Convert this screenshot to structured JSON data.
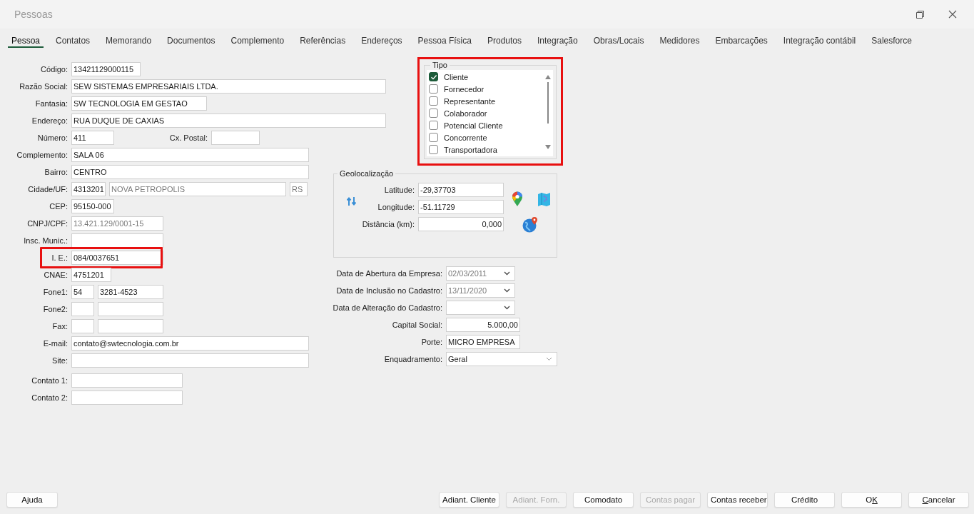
{
  "window": {
    "title": "Pessoas"
  },
  "tabs": [
    {
      "label": "Pessoa",
      "selected": true
    },
    {
      "label": "Contatos",
      "selected": false
    },
    {
      "label": "Memorando",
      "selected": false
    },
    {
      "label": "Documentos",
      "selected": false
    },
    {
      "label": "Complemento",
      "selected": false
    },
    {
      "label": "Referências",
      "selected": false
    },
    {
      "label": "Endereços",
      "selected": false
    },
    {
      "label": "Pessoa Física",
      "selected": false
    },
    {
      "label": "Produtos",
      "selected": false
    },
    {
      "label": "Integração",
      "selected": false
    },
    {
      "label": "Obras/Locais",
      "selected": false
    },
    {
      "label": "Medidores",
      "selected": false
    },
    {
      "label": "Embarcações",
      "selected": false
    },
    {
      "label": "Integração contábil",
      "selected": false
    },
    {
      "label": "Salesforce",
      "selected": false
    }
  ],
  "person_fields": [
    {
      "kind": "text",
      "label": "Código:",
      "fields": [
        {
          "value": "13421129000115",
          "disabled": false
        }
      ]
    },
    {
      "kind": "text",
      "label": "Razão Social:",
      "fields": [
        {
          "value": "SEW SISTEMAS EMPRESARIAIS LTDA.",
          "disabled": false
        }
      ]
    },
    {
      "kind": "text",
      "label": "Fantasia:",
      "fields": [
        {
          "value": "SW TECNOLOGIA EM GESTAO",
          "disabled": false
        }
      ]
    },
    {
      "kind": "text",
      "label": "Endereço:",
      "fields": [
        {
          "value": "RUA DUQUE DE CAXIAS",
          "disabled": false
        }
      ]
    },
    {
      "kind": "text",
      "label": "Número:",
      "fields": [
        {
          "value": "411",
          "disabled": false
        }
      ],
      "secondary": {
        "label": "Cx. Postal:"
      }
    },
    {
      "kind": "text",
      "label": "Complemento:",
      "fields": [
        {
          "value": "SALA 06",
          "disabled": false
        }
      ]
    },
    {
      "kind": "text",
      "label": "Bairro:",
      "fields": [
        {
          "value": "CENTRO",
          "disabled": false
        }
      ]
    },
    {
      "kind": "city",
      "label": "Cidade/UF:",
      "fields": [
        {
          "value": "4313201",
          "disabled": false
        },
        {
          "value": "NOVA PETROPOLIS",
          "disabled": true
        },
        {
          "value": "RS",
          "disabled": true
        }
      ]
    },
    {
      "kind": "text",
      "label": "CEP:",
      "fields": [
        {
          "value": "95150-000",
          "disabled": false
        }
      ]
    },
    {
      "kind": "text",
      "label": "CNPJ/CPF:",
      "fields": [
        {
          "value": "13.421.129/0001-15",
          "disabled": true
        }
      ]
    },
    {
      "kind": "text",
      "label": "Insc. Munic.:"
    },
    {
      "kind": "text",
      "label": "I. E.:",
      "highlighted": true,
      "fields": [
        {
          "value": "084/0037651",
          "disabled": false
        }
      ]
    },
    {
      "kind": "text",
      "label": "CNAE:",
      "fields": [
        {
          "value": "4751201",
          "disabled": false
        }
      ]
    },
    {
      "kind": "phone",
      "label": "Fone1:",
      "fields": [
        {
          "value": "54",
          "disabled": false
        },
        {
          "value": "3281-4523",
          "disabled": false
        }
      ]
    },
    {
      "kind": "phone",
      "label": "Fone2:"
    },
    {
      "kind": "phone",
      "label": "Fax:"
    },
    {
      "kind": "text",
      "label": "E-mail:",
      "fields": [
        {
          "value": "contato@swtecnologia.com.br",
          "disabled": false
        }
      ]
    },
    {
      "kind": "text",
      "label": "Site:"
    },
    {
      "kind": "text",
      "label": "Contato 1:"
    },
    {
      "kind": "text",
      "label": "Contato 2:"
    }
  ],
  "tipo": {
    "title": "Tipo",
    "highlighted": true,
    "items": [
      {
        "label": "Cliente",
        "checked": true
      },
      {
        "label": "Fornecedor",
        "checked": false
      },
      {
        "label": "Representante",
        "checked": false
      },
      {
        "label": "Colaborador",
        "checked": false
      },
      {
        "label": "Potencial Cliente",
        "checked": false
      },
      {
        "label": "Concorrente",
        "checked": false
      },
      {
        "label": "Transportadora",
        "checked": false
      }
    ]
  },
  "geolocation": {
    "title": "Geolocalização",
    "rows": [
      {
        "kind": "coordinate",
        "label": "Latitude:",
        "value": "-29,37703"
      },
      {
        "kind": "coordinate",
        "label": "Longitude:",
        "value": "-51.11729"
      },
      {
        "kind": "number",
        "label": "Distância (km):",
        "value": "0,000"
      }
    ]
  },
  "company_fields": [
    {
      "kind": "date",
      "label": "Data de Abertura da Empresa:",
      "value": "02/03/2011",
      "disabled": true
    },
    {
      "kind": "date",
      "label": "Data de Inclusão no Cadastro:",
      "value": "13/11/2020",
      "disabled": true
    },
    {
      "kind": "date",
      "label": "Data de Alteração do Cadastro:"
    },
    {
      "kind": "number",
      "label": "Capital Social:",
      "value": "5.000,00",
      "disabled": false
    },
    {
      "kind": "text",
      "label": "Porte:",
      "value": "MICRO EMPRESA",
      "disabled": false
    },
    {
      "kind": "select",
      "label": "Enquadramento:",
      "value": "Geral",
      "disabled": false
    }
  ],
  "help_button": {
    "label": "Ajuda"
  },
  "buttons": [
    {
      "label": "Adiant. Cliente",
      "disabled": false
    },
    {
      "label": "Adiant. Forn.",
      "disabled": true
    },
    {
      "label": "Comodato",
      "disabled": false
    },
    {
      "label": "Contas pagar",
      "disabled": true
    },
    {
      "label": "Contas receber",
      "disabled": false
    },
    {
      "label": "Crédito",
      "disabled": false
    },
    {
      "label": "OK",
      "disabled": false
    },
    {
      "label": "Cancelar",
      "disabled": false
    }
  ]
}
